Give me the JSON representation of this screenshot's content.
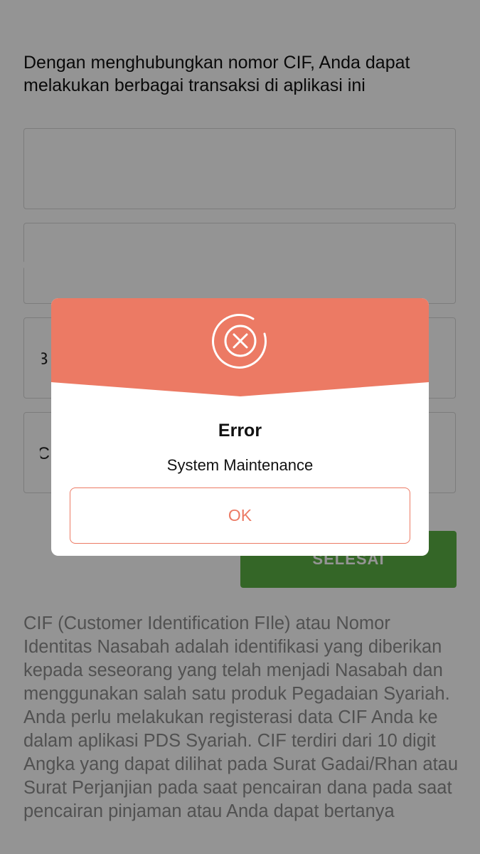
{
  "intro": {
    "text": "Dengan menghubungkan nomor CIF, Anda dapat melakukan berbagai transaksi di aplikasi ini"
  },
  "form": {
    "fields": [
      {
        "value": ""
      },
      {
        "value": ""
      },
      {
        "value": "(3"
      },
      {
        "value": "IC"
      }
    ],
    "done_label": "SELESAI"
  },
  "explanation": {
    "text": "CIF (Customer Identification FIle) atau Nomor Identitas Nasabah adalah identifikasi yang diberikan kepada seseorang yang telah menjadi Nasabah dan menggunakan salah satu produk Pegadaian Syariah. Anda perlu melakukan registerasi data CIF Anda ke dalam aplikasi PDS Syariah. CIF terdiri dari 10 digit Angka yang dapat dilihat pada Surat Gadai/Rhan atau Surat Perjanjian pada saat pencairan dana pada saat pencairan pinjaman atau Anda dapat bertanya"
  },
  "dialog": {
    "icon": "error-circle-x-icon",
    "title": "Error",
    "message": "System Maintenance",
    "ok_label": "OK"
  },
  "colors": {
    "dialog_header": "#ec7a64",
    "accent_text": "#ec7a64",
    "done_button": "#5bb044",
    "overlay": "rgba(0,0,0,0.42)"
  }
}
